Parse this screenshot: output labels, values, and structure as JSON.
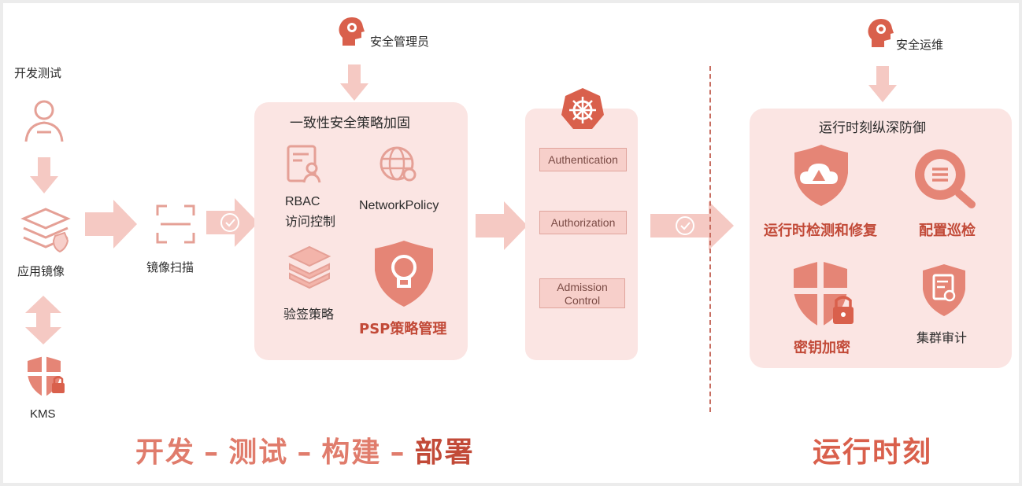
{
  "roles": {
    "security_admin": "安全管理员",
    "security_ops": "安全运维"
  },
  "left_column": {
    "dev_test_label": "开发测试",
    "app_image_label": "应用镜像",
    "kms_label": "KMS"
  },
  "image_scan_label": "镜像扫描",
  "policy_panel": {
    "title": "一致性安全策略加固",
    "rbac_line1": "RBAC",
    "rbac_line2": "访问控制",
    "network_policy": "NetworkPolicy",
    "signature_policy": "验签策略",
    "psp_policy": "PSP策略管理"
  },
  "k8s_panel": {
    "authentication": "Authentication",
    "authorization": "Authorization",
    "admission_line1": "Admission",
    "admission_line2": "Control"
  },
  "runtime_panel": {
    "title": "运行时刻纵深防御",
    "detect_repair": "运行时检测和修复",
    "config_inspection": "配置巡检",
    "key_encryption": "密钥加密",
    "cluster_audit": "集群审计"
  },
  "footer": {
    "stage_1": "开发",
    "dash": "–",
    "stage_2": "测试",
    "stage_3": "构建",
    "stage_4": "部署",
    "runtime": "运行时刻"
  },
  "colors": {
    "accent": "#d9604c",
    "light_accent": "#f7cfca",
    "panel_bg": "#fbe5e3",
    "arrow": "#f5c9c3"
  }
}
